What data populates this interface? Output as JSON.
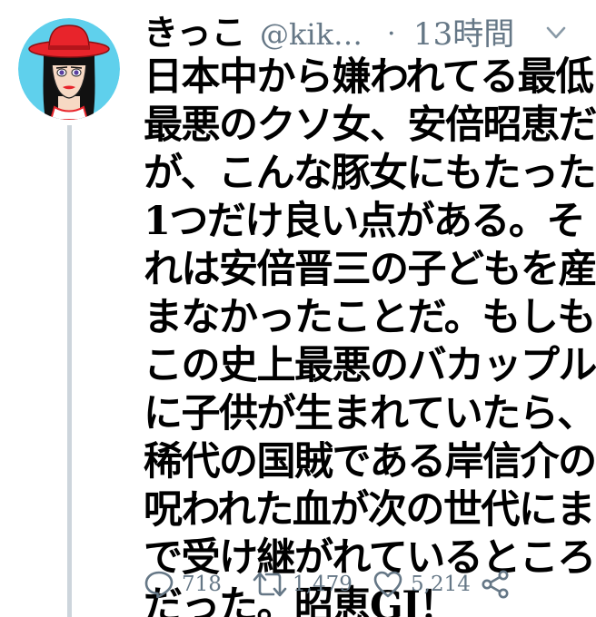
{
  "tweet": {
    "author": {
      "display_name": "きっこ",
      "handle": "@kik…",
      "avatar": "illustrated-woman-red-hat-avatar"
    },
    "separator": "·",
    "timestamp": "13時間",
    "menu_icon": "chevron-down-icon",
    "text": "日本中から嫌われてる最低\n最悪のクソ女、安倍昭恵だ\nが、こんな豚女にもたった\n1つだけ良い点がある。そ\nれは安倍晋三の子どもを産\nまなかったことだ。もしも\nこの史上最悪のバカップル\nに子供が生まれていたら、\n稀代の国賊である岸信介の\n呪われた血が次の世代にま\nで受け継がれているところ\nだった。昭恵GJ！",
    "actions": {
      "reply": {
        "icon": "reply-icon",
        "count": "718"
      },
      "retweet": {
        "icon": "retweet-icon",
        "count": "1,479"
      },
      "like": {
        "icon": "heart-icon",
        "count": "5,214"
      },
      "share": {
        "icon": "share-icon"
      }
    }
  },
  "colors": {
    "text": "#000000",
    "secondary": "#657786",
    "thread_line": "#cdd5dc",
    "avatar_background": "#5fd0ec",
    "hat": "#e8242b"
  }
}
